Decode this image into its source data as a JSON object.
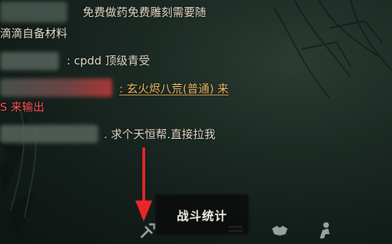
{
  "chat": {
    "lines": [
      {
        "text": "免费做药免费雕刻需要随",
        "color": "#e9e2cf"
      },
      {
        "text": "滴滴自备材料",
        "color": "#e9e2cf"
      },
      {
        "text": ": cpdd 顶级青受",
        "color": "#e9e2cf"
      },
      {
        "text": ": 玄火烬八荒(普通) 来",
        "color": "#f0c16b"
      },
      {
        "text": "S 来输出",
        "color": "#ff5a5a"
      },
      {
        "text": ". 求个天恒帮.直接拉我",
        "color": "#e9e2cf"
      }
    ]
  },
  "tooltip": {
    "label": "战斗统计"
  },
  "toolbar": {
    "icons": [
      "combat-stats-icon",
      "menu-icon",
      "handshake-icon",
      "character-icon"
    ]
  },
  "annotation": {
    "arrow_color": "#e8262a"
  }
}
